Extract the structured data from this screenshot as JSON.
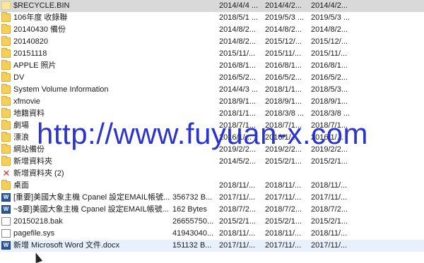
{
  "files": [
    {
      "icon": "blank-folder-icon",
      "name": "$RECYCLE.BIN",
      "size": "",
      "d1": "2014/4/4 ...",
      "d2": "2014/4/2...",
      "d3": "2014/4/2..."
    },
    {
      "icon": "folder-icon",
      "name": "106年度          收錄聯",
      "size": "",
      "d1": "2018/5/1 ...",
      "d2": "2019/5/3 ...",
      "d3": "2019/5/3 ..."
    },
    {
      "icon": "folder-icon",
      "name": "20140430 備份",
      "size": "",
      "d1": "2014/8/2...",
      "d2": "2014/8/2...",
      "d3": "2014/8/2..."
    },
    {
      "icon": "folder-icon",
      "name": "20140820",
      "size": "",
      "d1": "2014/8/2...",
      "d2": "2015/12/...",
      "d3": "2015/12/..."
    },
    {
      "icon": "folder-icon",
      "name": "20151118",
      "size": "",
      "d1": "2015/11/...",
      "d2": "2015/11/...",
      "d3": "2015/11/..."
    },
    {
      "icon": "folder-icon",
      "name": "APPLE 照片",
      "size": "",
      "d1": "2016/8/1...",
      "d2": "2016/8/1...",
      "d3": "2016/8/1..."
    },
    {
      "icon": "folder-icon",
      "name": "DV",
      "size": "",
      "d1": "2016/5/2...",
      "d2": "2016/5/2...",
      "d3": "2016/5/2..."
    },
    {
      "icon": "folder-icon",
      "name": "System Volume Information",
      "size": "",
      "d1": "2014/4/3 ...",
      "d2": "2018/1/1...",
      "d3": "2018/5/3..."
    },
    {
      "icon": "folder-icon",
      "name": "xfmovie",
      "size": "",
      "d1": "2018/9/1...",
      "d2": "2018/9/1...",
      "d3": "2018/9/1..."
    },
    {
      "icon": "folder-icon",
      "name": "地籍資料",
      "size": "",
      "d1": "2018/1/1...",
      "d2": "2018/3/8 ...",
      "d3": "2018/3/8 ..."
    },
    {
      "icon": "folder-icon",
      "name": "劇場",
      "size": "",
      "d1": "2018/7/1...",
      "d2": "2018/7/1...",
      "d3": "2018/7/1..."
    },
    {
      "icon": "folder-icon",
      "name": "漂浪",
      "size": "",
      "d1": "2016/1/...",
      "d2": "2016/1/...",
      "d3": "2016/1/..."
    },
    {
      "icon": "folder-icon",
      "name": "網站備份",
      "size": "",
      "d1": "2019/2/2...",
      "d2": "2019/2/2...",
      "d3": "2019/2/2..."
    },
    {
      "icon": "folder-icon",
      "name": "新增資料夾",
      "size": "",
      "d1": "2014/5/2...",
      "d2": "2015/2/1...",
      "d3": "2015/2/1..."
    },
    {
      "icon": "red-x-icon",
      "name": "新增資料夾 (2)",
      "size": "",
      "d1": "",
      "d2": "",
      "d3": ""
    },
    {
      "icon": "folder-icon",
      "name": "桌面",
      "size": "",
      "d1": "2018/11/...",
      "d2": "2018/11/...",
      "d3": "2018/11/..."
    },
    {
      "icon": "word-icon",
      "name": "[重要]美國大象主機 Cpanel 設定EMAIL帳號...",
      "size": "356732 B...",
      "d1": "2017/11/...",
      "d2": "2017/11/...",
      "d3": "2017/11/..."
    },
    {
      "icon": "word-icon",
      "name": "~$要]美國大象主機 Cpanel 設定EMAIL帳號...",
      "size": "162 Bytes",
      "d1": "2018/7/2...",
      "d2": "2018/7/2...",
      "d3": "2018/7/2..."
    },
    {
      "icon": "file-icon",
      "name": "20150218.bak",
      "size": "26655750...",
      "d1": "2015/2/1...",
      "d2": "2015/2/1...",
      "d3": "2015/2/1..."
    },
    {
      "icon": "file-icon",
      "name": "pagefile.sys",
      "size": "41943040...",
      "d1": "2018/11/...",
      "d2": "2018/11/...",
      "d3": "2018/11/..."
    },
    {
      "icon": "word-icon",
      "name": "新增 Microsoft Word 文件.docx",
      "size": "151132 B...",
      "d1": "2017/11/...",
      "d2": "2017/11/...",
      "d3": "2017/11/..."
    }
  ],
  "watermark": "http://www.fuyuan-x.com"
}
